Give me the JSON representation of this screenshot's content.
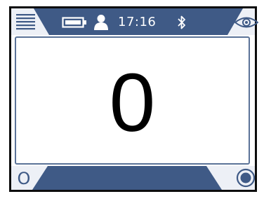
{
  "status_bar": {
    "time": "17:16",
    "icons": [
      "menu-icon",
      "battery-icon",
      "user-icon",
      "bluetooth-icon",
      "eye-icon"
    ]
  },
  "display": {
    "reading": "0"
  },
  "bottom_bar": {
    "left_button_label": "O",
    "right_button_icon": "record-icon"
  },
  "colors": {
    "accent": "#3f5a86",
    "bar_background": "#edf0f6",
    "frame": "#0d0d0d"
  }
}
